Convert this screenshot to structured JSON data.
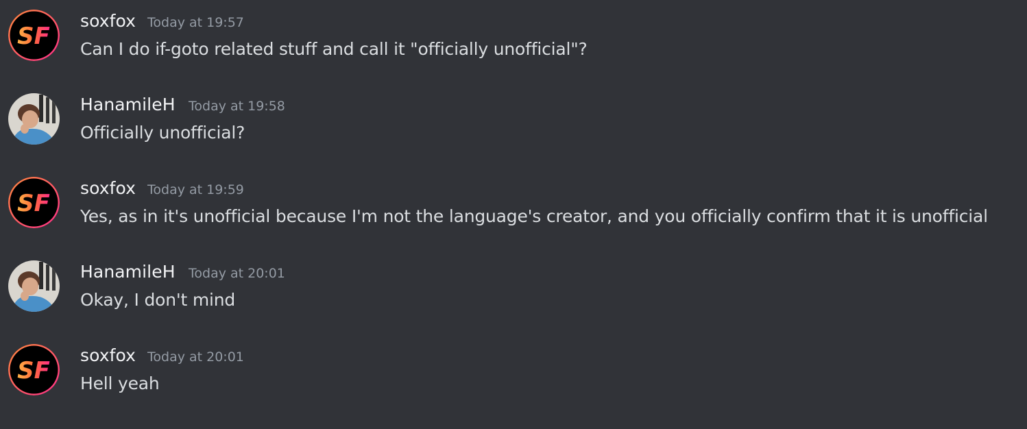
{
  "theme": {
    "background": "#313338",
    "username_color": "#f2f3f5",
    "text_color": "#dbdee1",
    "timestamp_color": "#949ba4"
  },
  "messages": [
    {
      "author": "soxfox",
      "avatar": "soxfox-logo-icon",
      "timestamp": "Today at 19:57",
      "content": "Can I do if-goto related stuff and call it \"officially unofficial\"?"
    },
    {
      "author": "HanamileH",
      "avatar": "hanamileh-photo-avatar",
      "timestamp": "Today at 19:58",
      "content": "Officially unofficial?"
    },
    {
      "author": "soxfox",
      "avatar": "soxfox-logo-icon",
      "timestamp": "Today at 19:59",
      "content": "Yes, as in it's unofficial because I'm not the language's creator, and you officially confirm that it is unofficial"
    },
    {
      "author": "HanamileH",
      "avatar": "hanamileh-photo-avatar",
      "timestamp": "Today at 20:01",
      "content": "Okay, I don't mind"
    },
    {
      "author": "soxfox",
      "avatar": "soxfox-logo-icon",
      "timestamp": "Today at 20:01",
      "content": "Hell yeah"
    }
  ]
}
